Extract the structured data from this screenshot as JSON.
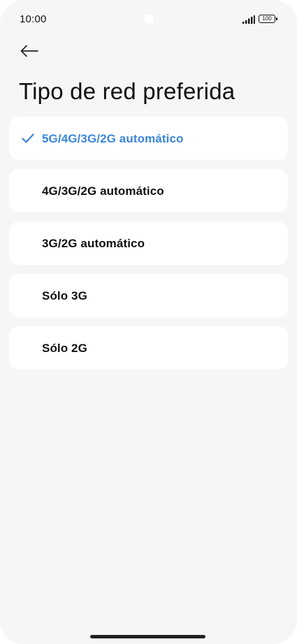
{
  "status_bar": {
    "time": "10:00",
    "battery_level": "100"
  },
  "header": {
    "back_icon": "arrow-left-icon",
    "title": "Tipo de red preferida"
  },
  "options": [
    {
      "label": "5G/4G/3G/2G automático",
      "selected": true
    },
    {
      "label": "4G/3G/2G automático",
      "selected": false
    },
    {
      "label": "3G/2G automático",
      "selected": false
    },
    {
      "label": "Sólo 3G",
      "selected": false
    },
    {
      "label": "Sólo 2G",
      "selected": false
    }
  ],
  "colors": {
    "accent": "#3a86dc",
    "background": "#f6f6f6",
    "card": "#ffffff",
    "text": "#111111"
  }
}
